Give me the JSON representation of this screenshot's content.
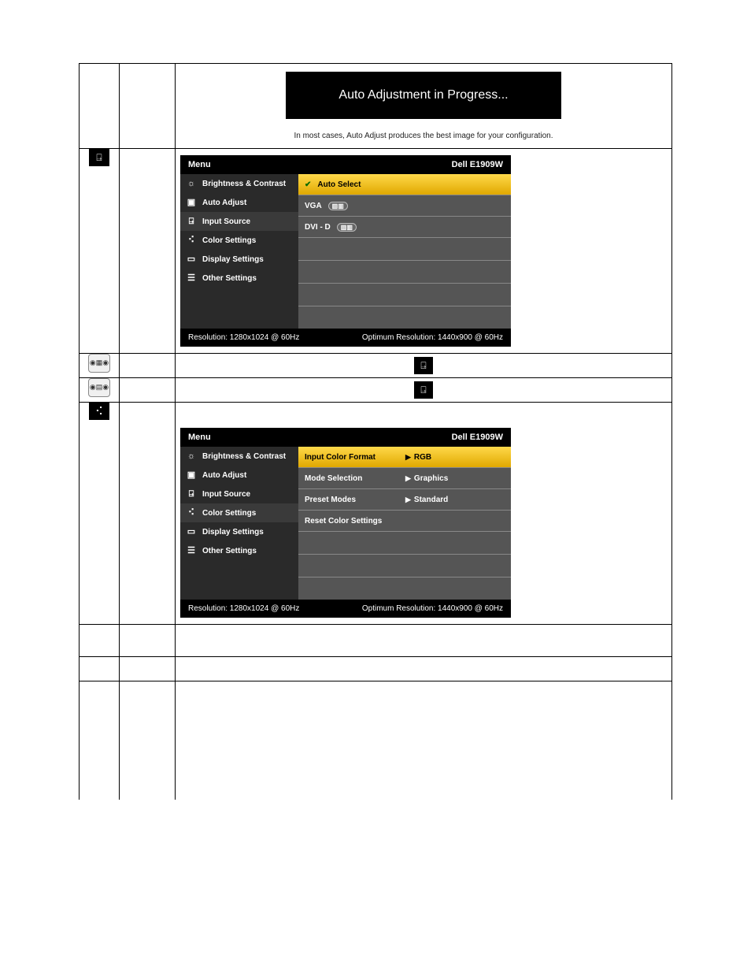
{
  "progress_text": "Auto Adjustment in Progress...",
  "caption_text": "In most cases, Auto Adjust produces the best image for your configuration.",
  "osd": {
    "menu_label": "Menu",
    "model": "Dell E1909W",
    "left_items": [
      "Brightness & Contrast",
      "Auto Adjust",
      "Input Source",
      "Color Settings",
      "Display Settings",
      "Other Settings"
    ],
    "footer_left": "Resolution: 1280x1024 @ 60Hz",
    "footer_right": "Optimum Resolution: 1440x900 @ 60Hz"
  },
  "osd1_right": {
    "auto_select": "Auto Select",
    "vga": "VGA",
    "dvid": "DVI - D"
  },
  "osd2_right": {
    "input_color_format": "Input Color Format",
    "mode_selection": "Mode Selection",
    "preset_modes": "Preset Modes",
    "reset_color": "Reset Color Settings",
    "val_rgb": "RGB",
    "val_graphics": "Graphics",
    "val_standard": "Standard"
  }
}
